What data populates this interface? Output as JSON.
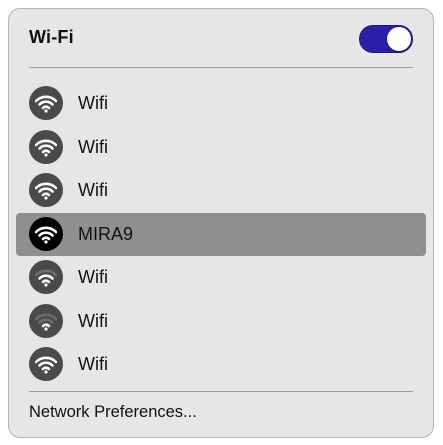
{
  "header": {
    "title": "Wi-Fi",
    "toggle_on": true,
    "toggle_color": "#2a1fa8"
  },
  "networks": [
    {
      "name": "Wifi",
      "icon": "wifi-icon",
      "selected": false
    },
    {
      "name": "Wifi",
      "icon": "wifi-icon",
      "selected": false
    },
    {
      "name": "Wifi",
      "icon": "wifi-icon",
      "selected": false
    },
    {
      "name": "MIRA9",
      "icon": "wifi-icon",
      "selected": true
    },
    {
      "name": "Wifi",
      "icon": "wifi-icon",
      "selected": false
    },
    {
      "name": "Wifi",
      "icon": "wifi-icon",
      "selected": false
    },
    {
      "name": "Wifi",
      "icon": "wifi-icon",
      "selected": false
    }
  ],
  "footer": {
    "preferences_label": "Network Preferences..."
  },
  "colors": {
    "menu_background": "#e6e6e6",
    "selected_row": "#8f8f8f",
    "icon_badge": "#4a4a4a",
    "icon_badge_selected": "#000000"
  }
}
